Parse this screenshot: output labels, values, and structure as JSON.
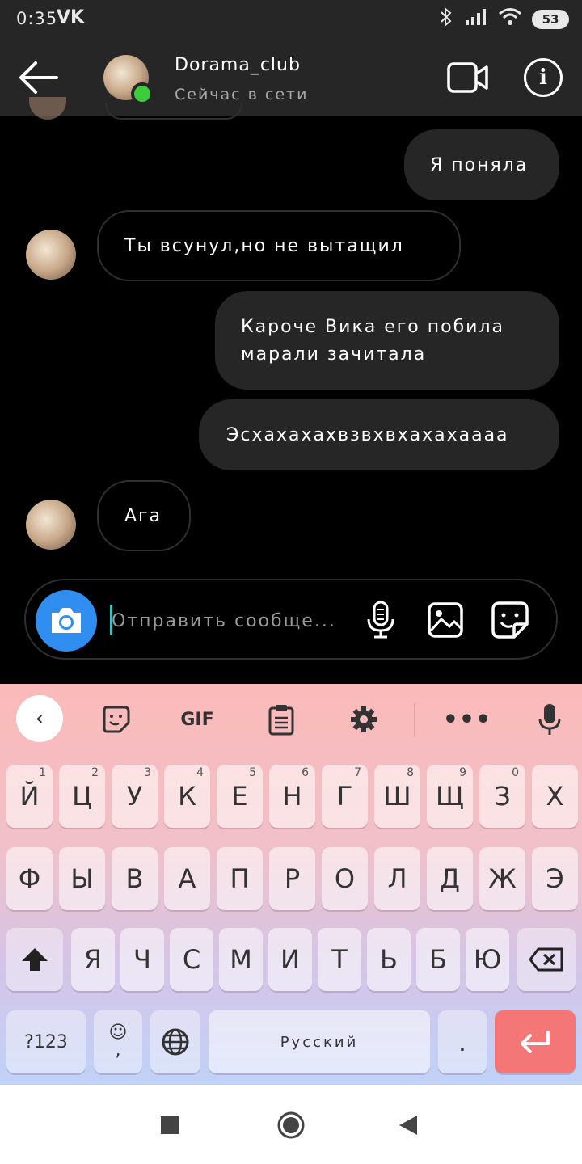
{
  "status_bar": {
    "time": "0:35",
    "app_icon": "VK",
    "battery": "53"
  },
  "header": {
    "name": "Dorama_club",
    "status": "Сейчас в сети"
  },
  "messages": [
    {
      "side": "out",
      "text": "Я поняла"
    },
    {
      "side": "in",
      "text": "Ты всунул,но не вытащил"
    },
    {
      "side": "out",
      "lines": [
        "Кароче Вика его побила",
        "марали зачитала"
      ]
    },
    {
      "side": "out",
      "text": "Эсхахахахвзвхвхахахаааа"
    },
    {
      "side": "in",
      "text": "Ага"
    }
  ],
  "composer": {
    "placeholder": "Отправить сообще..."
  },
  "keyboard": {
    "toolbar": {
      "gif_label": "GIF"
    },
    "row1": [
      {
        "k": "й",
        "h": "1"
      },
      {
        "k": "ц",
        "h": "2"
      },
      {
        "k": "у",
        "h": "3"
      },
      {
        "k": "к",
        "h": "4"
      },
      {
        "k": "е",
        "h": "5"
      },
      {
        "k": "н",
        "h": "6"
      },
      {
        "k": "г",
        "h": "7"
      },
      {
        "k": "ш",
        "h": "8"
      },
      {
        "k": "щ",
        "h": "9"
      },
      {
        "k": "з",
        "h": "0"
      },
      {
        "k": "х",
        "h": ""
      }
    ],
    "row2": [
      "ф",
      "ы",
      "в",
      "а",
      "п",
      "р",
      "о",
      "л",
      "д",
      "ж",
      "э"
    ],
    "row3": [
      "я",
      "ч",
      "с",
      "м",
      "и",
      "т",
      "ь",
      "б",
      "ю"
    ],
    "row4": {
      "symbols": "?123",
      "comma": ",",
      "space": "Русский",
      "period": "."
    }
  }
}
